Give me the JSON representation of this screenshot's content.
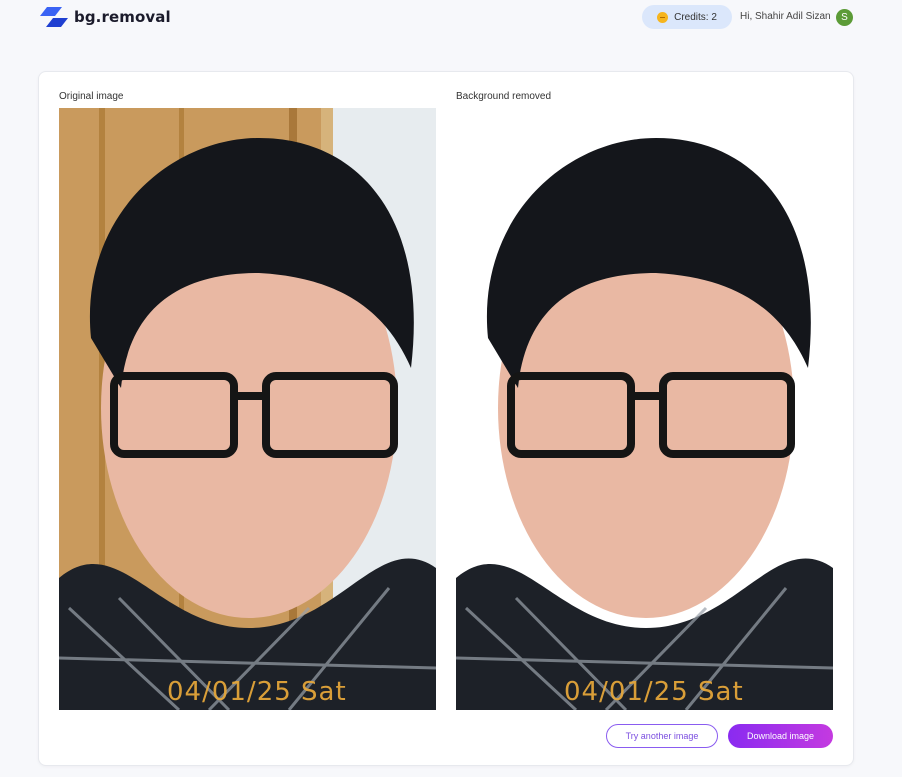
{
  "header": {
    "logo_text": "bg.removal",
    "credits_label": "Credits: 2",
    "greeting": "Hi, Shahir Adil Sizan",
    "avatar_initial": "S"
  },
  "panels": {
    "original_label": "Original image",
    "removed_label": "Background removed",
    "photo_stamp": "04/01/25 Sat"
  },
  "actions": {
    "try_another_label": "Try another image",
    "download_label": "Download image"
  },
  "colors": {
    "brand_blue": "#3b5cf6",
    "accent_purple": "#8a2bf0",
    "coin_gold": "#f6b51e",
    "avatar_green": "#5c9b37"
  },
  "icons": {
    "logo": "bg-removal-logo-icon",
    "coin": "coin-icon"
  }
}
